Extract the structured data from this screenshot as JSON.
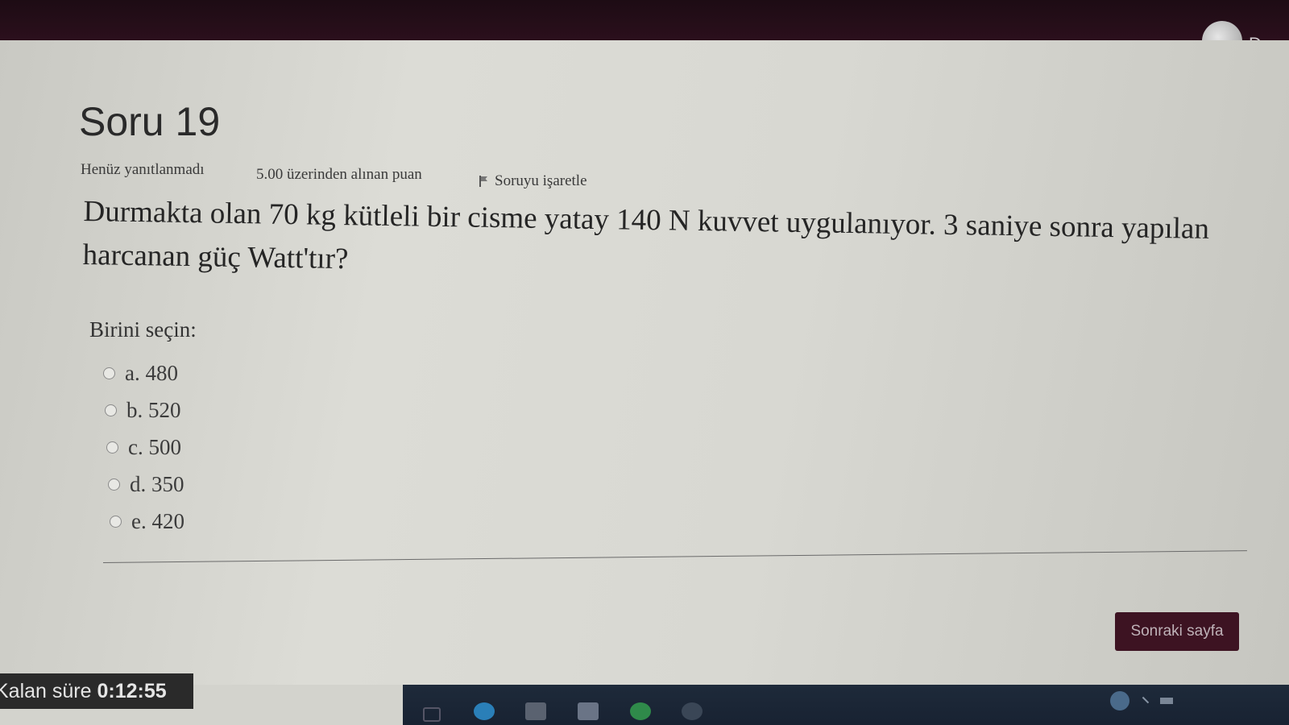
{
  "header": {
    "user_name": "Ders"
  },
  "question": {
    "title": "Soru 19",
    "status": "Henüz yanıtlanmadı",
    "points": "5.00 üzerinden alınan puan",
    "flag_label": "Soruyu işaretle",
    "text_line1": "Durmakta olan 70 kg kütleli bir cisme yatay 140 N kuvvet uygulanıyor. 3 saniye sonra yapılan",
    "text_line2": "harcanan güç Watt'tır?",
    "prompt": "Birini seçin:",
    "answers": [
      "a. 480",
      "b. 520",
      "c. 500",
      "d. 350",
      "e. 420"
    ]
  },
  "navigation": {
    "next_label": "Sonraki sayfa"
  },
  "timer": {
    "label": "Kalan süre ",
    "value": "0:12:55"
  },
  "colors": {
    "topbar": "#2b0f1c",
    "button": "#3d1322",
    "content_bg": "#d6d6d0"
  }
}
